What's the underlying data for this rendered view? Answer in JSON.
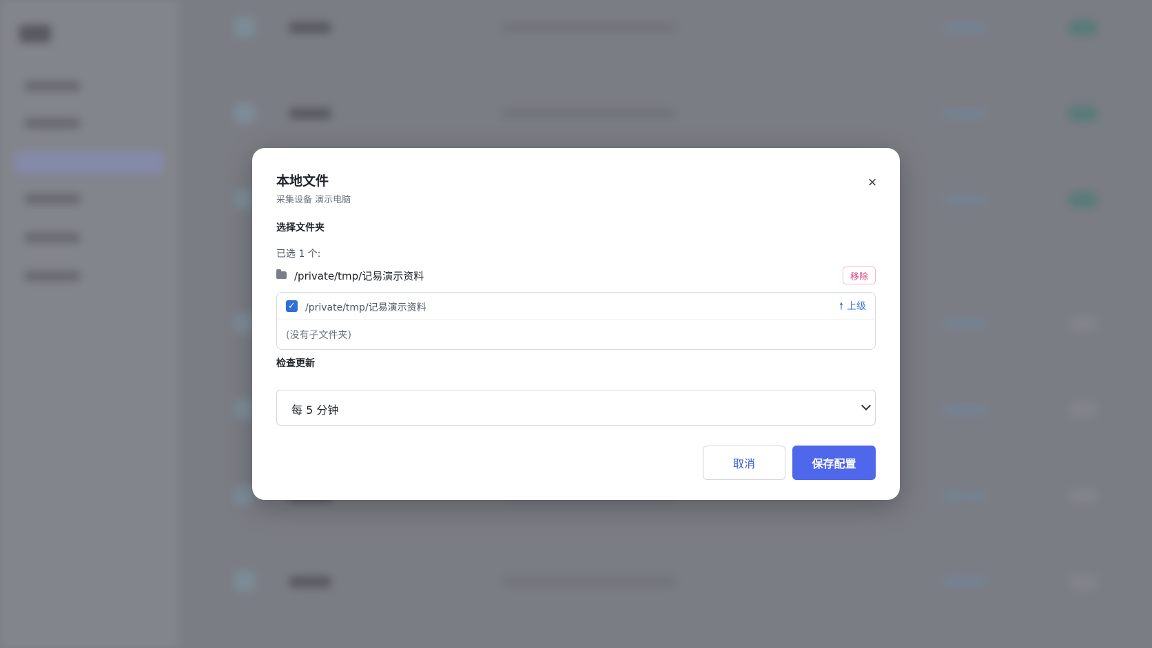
{
  "modal": {
    "title": "本地文件",
    "subtitle": "采集设备 演示电脑",
    "close_icon": "×",
    "folder_section": {
      "label": "选择文件夹",
      "selected_count": "已选 1 个:",
      "selected_path": "/private/tmp/记易演示资料",
      "remove_label": "移除"
    },
    "browser": {
      "current_path": "/private/tmp/记易演示资料",
      "checked": true,
      "up_icon": "🠕",
      "up_label": "上级",
      "empty_hint": "(没有子文件夹)"
    },
    "update_section": {
      "label": "检查更新",
      "selected_value": "每 5 分钟"
    },
    "buttons": {
      "cancel": "取消",
      "save": "保存配置"
    }
  },
  "colors": {
    "accent": "#4f67ea",
    "remove": "#e0427f",
    "link": "#3b6fe0"
  },
  "icons": [
    "close-icon",
    "folder-icon",
    "checkbox-checked-icon",
    "arrow-up-icon",
    "chevron-down-icon"
  ]
}
